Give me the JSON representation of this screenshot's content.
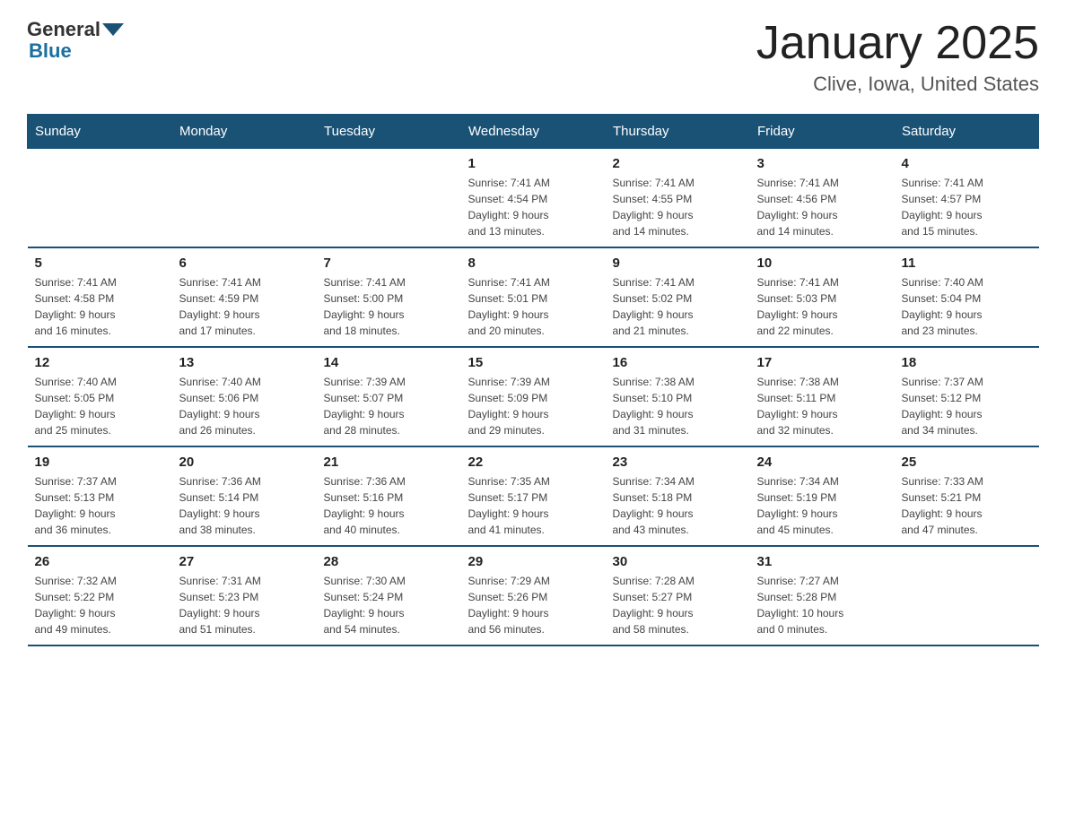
{
  "logo": {
    "general": "General",
    "arrow": "",
    "blue": "Blue"
  },
  "title": "January 2025",
  "subtitle": "Clive, Iowa, United States",
  "days_of_week": [
    "Sunday",
    "Monday",
    "Tuesday",
    "Wednesday",
    "Thursday",
    "Friday",
    "Saturday"
  ],
  "weeks": [
    [
      {
        "day": "",
        "info": ""
      },
      {
        "day": "",
        "info": ""
      },
      {
        "day": "",
        "info": ""
      },
      {
        "day": "1",
        "info": "Sunrise: 7:41 AM\nSunset: 4:54 PM\nDaylight: 9 hours\nand 13 minutes."
      },
      {
        "day": "2",
        "info": "Sunrise: 7:41 AM\nSunset: 4:55 PM\nDaylight: 9 hours\nand 14 minutes."
      },
      {
        "day": "3",
        "info": "Sunrise: 7:41 AM\nSunset: 4:56 PM\nDaylight: 9 hours\nand 14 minutes."
      },
      {
        "day": "4",
        "info": "Sunrise: 7:41 AM\nSunset: 4:57 PM\nDaylight: 9 hours\nand 15 minutes."
      }
    ],
    [
      {
        "day": "5",
        "info": "Sunrise: 7:41 AM\nSunset: 4:58 PM\nDaylight: 9 hours\nand 16 minutes."
      },
      {
        "day": "6",
        "info": "Sunrise: 7:41 AM\nSunset: 4:59 PM\nDaylight: 9 hours\nand 17 minutes."
      },
      {
        "day": "7",
        "info": "Sunrise: 7:41 AM\nSunset: 5:00 PM\nDaylight: 9 hours\nand 18 minutes."
      },
      {
        "day": "8",
        "info": "Sunrise: 7:41 AM\nSunset: 5:01 PM\nDaylight: 9 hours\nand 20 minutes."
      },
      {
        "day": "9",
        "info": "Sunrise: 7:41 AM\nSunset: 5:02 PM\nDaylight: 9 hours\nand 21 minutes."
      },
      {
        "day": "10",
        "info": "Sunrise: 7:41 AM\nSunset: 5:03 PM\nDaylight: 9 hours\nand 22 minutes."
      },
      {
        "day": "11",
        "info": "Sunrise: 7:40 AM\nSunset: 5:04 PM\nDaylight: 9 hours\nand 23 minutes."
      }
    ],
    [
      {
        "day": "12",
        "info": "Sunrise: 7:40 AM\nSunset: 5:05 PM\nDaylight: 9 hours\nand 25 minutes."
      },
      {
        "day": "13",
        "info": "Sunrise: 7:40 AM\nSunset: 5:06 PM\nDaylight: 9 hours\nand 26 minutes."
      },
      {
        "day": "14",
        "info": "Sunrise: 7:39 AM\nSunset: 5:07 PM\nDaylight: 9 hours\nand 28 minutes."
      },
      {
        "day": "15",
        "info": "Sunrise: 7:39 AM\nSunset: 5:09 PM\nDaylight: 9 hours\nand 29 minutes."
      },
      {
        "day": "16",
        "info": "Sunrise: 7:38 AM\nSunset: 5:10 PM\nDaylight: 9 hours\nand 31 minutes."
      },
      {
        "day": "17",
        "info": "Sunrise: 7:38 AM\nSunset: 5:11 PM\nDaylight: 9 hours\nand 32 minutes."
      },
      {
        "day": "18",
        "info": "Sunrise: 7:37 AM\nSunset: 5:12 PM\nDaylight: 9 hours\nand 34 minutes."
      }
    ],
    [
      {
        "day": "19",
        "info": "Sunrise: 7:37 AM\nSunset: 5:13 PM\nDaylight: 9 hours\nand 36 minutes."
      },
      {
        "day": "20",
        "info": "Sunrise: 7:36 AM\nSunset: 5:14 PM\nDaylight: 9 hours\nand 38 minutes."
      },
      {
        "day": "21",
        "info": "Sunrise: 7:36 AM\nSunset: 5:16 PM\nDaylight: 9 hours\nand 40 minutes."
      },
      {
        "day": "22",
        "info": "Sunrise: 7:35 AM\nSunset: 5:17 PM\nDaylight: 9 hours\nand 41 minutes."
      },
      {
        "day": "23",
        "info": "Sunrise: 7:34 AM\nSunset: 5:18 PM\nDaylight: 9 hours\nand 43 minutes."
      },
      {
        "day": "24",
        "info": "Sunrise: 7:34 AM\nSunset: 5:19 PM\nDaylight: 9 hours\nand 45 minutes."
      },
      {
        "day": "25",
        "info": "Sunrise: 7:33 AM\nSunset: 5:21 PM\nDaylight: 9 hours\nand 47 minutes."
      }
    ],
    [
      {
        "day": "26",
        "info": "Sunrise: 7:32 AM\nSunset: 5:22 PM\nDaylight: 9 hours\nand 49 minutes."
      },
      {
        "day": "27",
        "info": "Sunrise: 7:31 AM\nSunset: 5:23 PM\nDaylight: 9 hours\nand 51 minutes."
      },
      {
        "day": "28",
        "info": "Sunrise: 7:30 AM\nSunset: 5:24 PM\nDaylight: 9 hours\nand 54 minutes."
      },
      {
        "day": "29",
        "info": "Sunrise: 7:29 AM\nSunset: 5:26 PM\nDaylight: 9 hours\nand 56 minutes."
      },
      {
        "day": "30",
        "info": "Sunrise: 7:28 AM\nSunset: 5:27 PM\nDaylight: 9 hours\nand 58 minutes."
      },
      {
        "day": "31",
        "info": "Sunrise: 7:27 AM\nSunset: 5:28 PM\nDaylight: 10 hours\nand 0 minutes."
      },
      {
        "day": "",
        "info": ""
      }
    ]
  ]
}
